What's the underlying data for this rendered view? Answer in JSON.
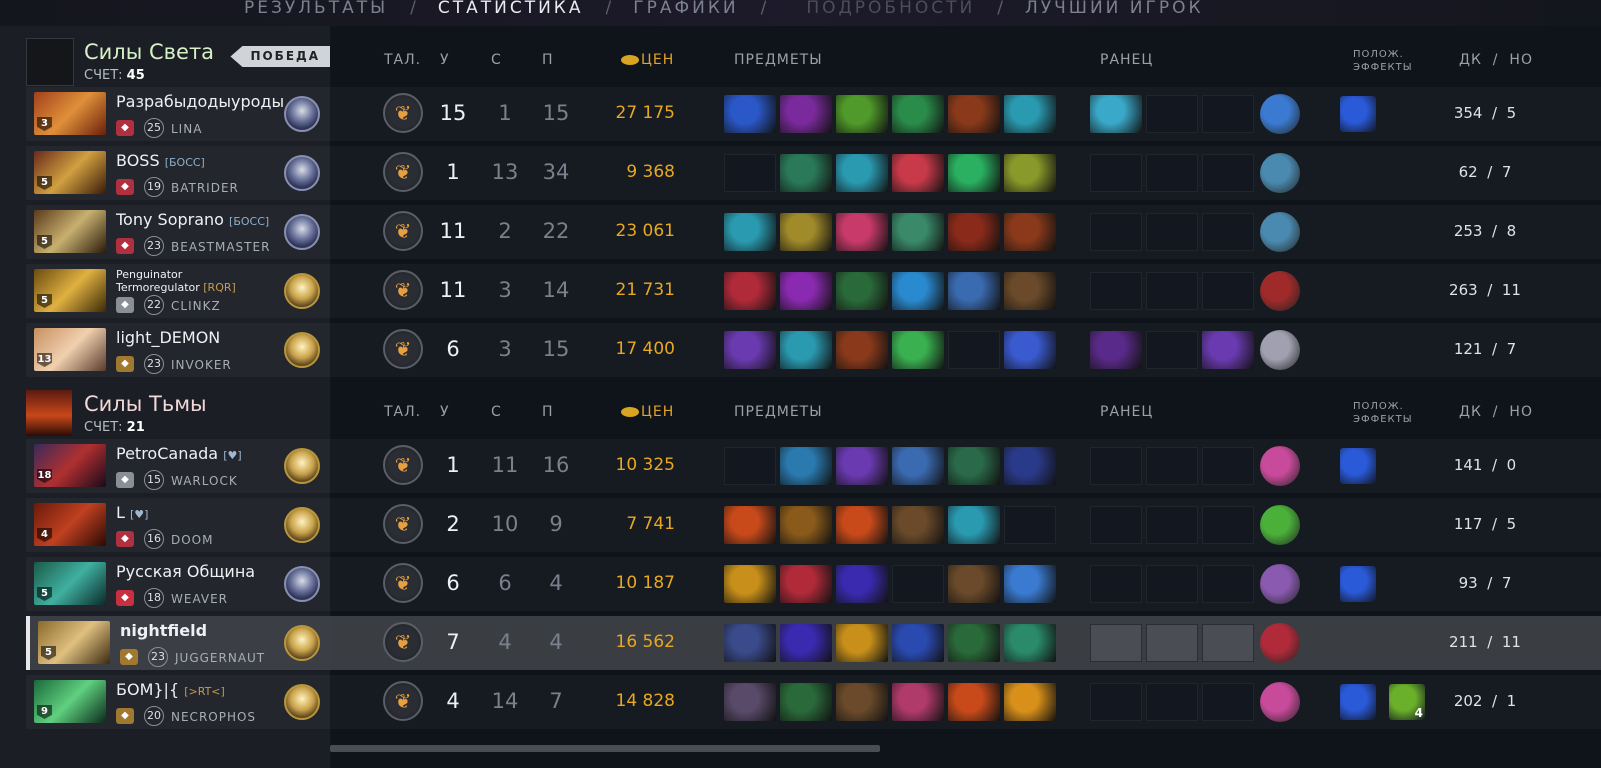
{
  "nav": {
    "tabs": [
      {
        "label": "РЕЗУЛЬТАТЫ"
      },
      {
        "label": "СТАТИСТИКА"
      },
      {
        "label": "ГРАФИКИ"
      },
      {
        "label": "ПОДРОБНОСТИ"
      },
      {
        "label": "ЛУЧШИЙ ИГРОК"
      }
    ],
    "separator": "/"
  },
  "columns": {
    "talent": "ТАЛ.",
    "kills": "У",
    "deaths": "С",
    "assists": "П",
    "networth": "ЦЕН",
    "items": "ПРЕДМЕТЫ",
    "backpack": "РАНЕЦ",
    "buffs_line1": "ПОЛОЖ.",
    "buffs_line2": "ЭФФЕКТЫ",
    "lasthits": "ДК",
    "slash": "/",
    "denies": "НО"
  },
  "radiant": {
    "name": "Силы Света",
    "score_label": "СЧЕТ:",
    "score": "45",
    "badge": "ПОБЕДА",
    "players": [
      {
        "name": "Разрабыдодыуроды",
        "tag": "",
        "level": "25",
        "hero": "LINA",
        "hero_level": "3",
        "kills": "15",
        "deaths": "1",
        "assists": "15",
        "networth": "27 175",
        "lh": "354",
        "dn": "5",
        "items": [
          "#2a58c8",
          "#7a2a9c",
          "#4f9a2a",
          "#2a8c4a",
          "#8a3a1a",
          "#2a9ab0"
        ],
        "backpack": [
          "#3aa8c8",
          "",
          ""
        ],
        "neutral": "#3a7ad0",
        "buffs": [
          "#2a5ad8"
        ],
        "hicolor": "#b03040",
        "portrait": "linear-gradient(135deg,#a0401a,#e0903a 50%,#6a200a)"
      },
      {
        "name": "BOSS",
        "tag": "[БОСС]",
        "level": "19",
        "hero": "BATRIDER",
        "hero_level": "5",
        "kills": "1",
        "deaths": "13",
        "assists": "34",
        "networth": "9 368",
        "lh": "62",
        "dn": "7",
        "items": [
          "",
          "#2a7a5a",
          "#2a9ab0",
          "#c83a4a",
          "#2ab060",
          "#8a9a2a"
        ],
        "backpack": [
          "",
          "",
          ""
        ],
        "neutral": "#4a8ab0",
        "buffs": [],
        "hicolor": "#b03040",
        "portrait": "linear-gradient(135deg,#6a2a1a,#d0a040 50%,#3a1a0a)"
      },
      {
        "name": "Tony Soprano",
        "tag": "[БОСС]",
        "level": "23",
        "hero": "BEASTMASTER",
        "hero_level": "5",
        "kills": "11",
        "deaths": "2",
        "assists": "22",
        "networth": "23 061",
        "lh": "253",
        "dn": "8",
        "items": [
          "#2a9ab0",
          "#a08a2a",
          "#c83a6a",
          "#3a8a6a",
          "#8a2a1a",
          "#8a3a1a"
        ],
        "backpack": [
          "",
          "",
          ""
        ],
        "neutral": "#4a8ab0",
        "buffs": [],
        "hicolor": "#b03040",
        "portrait": "linear-gradient(135deg,#5a3a1a,#c8b070 50%,#2a1a0a)"
      },
      {
        "name": "Penguinator Termoregulator",
        "tag": "[RQR]",
        "level": "22",
        "hero": "CLINKZ",
        "hero_level": "5",
        "kills": "11",
        "deaths": "3",
        "assists": "14",
        "networth": "21 731",
        "lh": "263",
        "dn": "11",
        "items": [
          "#b02a3a",
          "#8a2ab0",
          "#2a6a3a",
          "#2a8ad0",
          "#3a6ab0",
          "#6a4a2a"
        ],
        "backpack": [
          "",
          "",
          ""
        ],
        "neutral": "#a02a2a",
        "buffs": [],
        "hicolor": "#8a8e96",
        "portrait": "linear-gradient(135deg,#6a4a10,#e0b040 50%,#3a2a08)"
      },
      {
        "name": "light_DEMON",
        "tag": "",
        "level": "23",
        "hero": "INVOKER",
        "hero_level": "13",
        "kills": "6",
        "deaths": "3",
        "assists": "15",
        "networth": "17 400",
        "lh": "121",
        "dn": "7",
        "items": [
          "#6a3ab0",
          "#2a9ab0",
          "#8a3a1a",
          "#3ab050",
          "",
          "#3a5ad0"
        ],
        "backpack": [
          "#5a2a8a",
          "",
          "#6a3ab0"
        ],
        "neutral": "#a0a0b0",
        "buffs": [],
        "hicolor": "#a07830",
        "portrait": "linear-gradient(135deg,#c89060,#f0d0b0 50%,#5a3a2a)"
      }
    ]
  },
  "dire": {
    "name": "Силы Тьмы",
    "score_label": "СЧЕТ:",
    "score": "21",
    "players": [
      {
        "name": "PetroCanada",
        "tag": "[♥]",
        "level": "15",
        "hero": "WARLOCK",
        "hero_level": "18",
        "kills": "1",
        "deaths": "11",
        "assists": "16",
        "networth": "10 325",
        "lh": "141",
        "dn": "0",
        "items": [
          "",
          "#2a7ab0",
          "#6a3ab0",
          "#3a6ab0",
          "#2a6a4a",
          "#2a3a8a"
        ],
        "backpack": [
          "",
          "",
          ""
        ],
        "neutral": "#c84a9a",
        "buffs": [
          "#2a5ad8"
        ],
        "hicolor": "#8a8e96",
        "portrait": "linear-gradient(135deg,#3a2a5a,#b03030 50%,#1a0a1a)"
      },
      {
        "name": "L",
        "tag": "[♥]",
        "level": "16",
        "hero": "DOOM",
        "hero_level": "4",
        "kills": "2",
        "deaths": "10",
        "assists": "9",
        "networth": "7 741",
        "lh": "117",
        "dn": "5",
        "items": [
          "#c84a1a",
          "#8a5a1a",
          "#c84a1a",
          "#6a4a2a",
          "#2a9ab0",
          ""
        ],
        "backpack": [
          "",
          "",
          ""
        ],
        "neutral": "#4ab03a",
        "buffs": [],
        "hicolor": "#b03040",
        "portrait": "linear-gradient(135deg,#6a1a0a,#c04020 50%,#2a0a05)"
      },
      {
        "name": "Русская Община",
        "tag": "",
        "level": "18",
        "hero": "WEAVER",
        "hero_level": "5",
        "kills": "6",
        "deaths": "6",
        "assists": "4",
        "networth": "10 187",
        "lh": "93",
        "dn": "7",
        "items": [
          "#c8901a",
          "#b02a3a",
          "#3a2ab0",
          "",
          "#6a4a2a",
          "#3a7ad0"
        ],
        "backpack": [
          "",
          "",
          ""
        ],
        "neutral": "#8a5ab0",
        "buffs": [
          "#2a5ad8"
        ],
        "hicolor": "#c83040",
        "portrait": "linear-gradient(135deg,#1a5a4a,#40b0a0 50%,#0a2a2a)"
      },
      {
        "name": "nightfield",
        "tag": "",
        "level": "23",
        "hero": "JUGGERNAUT",
        "hero_level": "5",
        "kills": "7",
        "deaths": "4",
        "assists": "4",
        "networth": "16 562",
        "lh": "211",
        "dn": "11",
        "items": [
          "#3a4a8a",
          "#3a2ab0",
          "#c8901a",
          "#2a4ab0",
          "#2a6a3a",
          "#2a8a6a"
        ],
        "backpack": [
          "",
          "",
          ""
        ],
        "neutral": "#b02a3a",
        "buffs": [],
        "hicolor": "#a07830",
        "portrait": "linear-gradient(135deg,#8a6a2a,#e0c080 50%,#3a2a10)"
      },
      {
        "name": "БОМ}|{",
        "tag": "[>RT<]",
        "level": "20",
        "hero": "NECROPHOS",
        "hero_level": "9",
        "kills": "4",
        "deaths": "14",
        "assists": "7",
        "networth": "14 828",
        "lh": "202",
        "dn": "1",
        "items": [
          "#5a4a6a",
          "#2a6a3a",
          "#6a4a2a",
          "#b03a6a",
          "#c84a1a",
          "#d8901a"
        ],
        "backpack": [
          "",
          "",
          ""
        ],
        "neutral": "#c84a9a",
        "buffs": [
          "#2a5ad8",
          "#6ab02a"
        ],
        "buff_count": "4",
        "hicolor": "#a07830",
        "portrait": "linear-gradient(135deg,#1a6a3a,#60d080 50%,#0a2a1a)"
      }
    ]
  }
}
